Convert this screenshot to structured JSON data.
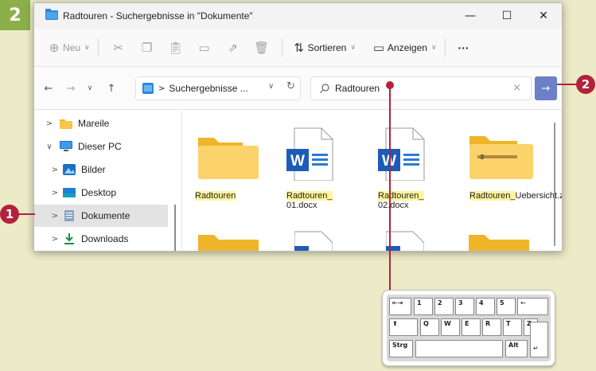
{
  "step_badge": "2",
  "window": {
    "title": "Radtouren - Suchergebnisse in \"Dokumente\"",
    "controls": {
      "minimize": "—",
      "maximize": "☐",
      "close": "✕"
    }
  },
  "toolbar": {
    "new_label": "Neu",
    "sort_label": "Sortieren",
    "view_label": "Anzeigen",
    "more_label": "···"
  },
  "address": {
    "path_label": "Suchergebnisse ...",
    "search_value": "Radtouren"
  },
  "nav_pane": {
    "items": [
      {
        "label": "Mareile",
        "arrow": ">",
        "icon": "folder-icon"
      },
      {
        "label": "Dieser PC",
        "arrow": "∨",
        "icon": "pc-icon"
      },
      {
        "label": "Bilder",
        "arrow": ">",
        "icon": "pictures-icon"
      },
      {
        "label": "Desktop",
        "arrow": ">",
        "icon": "desktop-icon"
      },
      {
        "label": "Dokumente",
        "arrow": ">",
        "icon": "document-icon"
      },
      {
        "label": "Downloads",
        "arrow": ">",
        "icon": "download-icon"
      }
    ]
  },
  "files": [
    {
      "name_hl": "Radtouren",
      "name_rest": "",
      "type": "folder"
    },
    {
      "name_hl": "Radtouren_",
      "name_rest": "01.docx",
      "type": "word"
    },
    {
      "name_hl": "Radtouren_",
      "name_rest": "02.docx",
      "type": "word"
    },
    {
      "name_hl": "Radtouren_",
      "name_rest": "Uebersicht.zip",
      "type": "zip"
    }
  ],
  "callouts": {
    "one": "1",
    "two": "2"
  },
  "keyboard": {
    "row1": [
      "1",
      "2",
      "3",
      "4",
      "5"
    ],
    "row2": [
      "Q",
      "W",
      "E",
      "R",
      "T",
      "Z"
    ],
    "ctrl": "Strg",
    "alt": "Alt"
  },
  "colors": {
    "accent": "#6c7fc7",
    "callout": "#b3213c",
    "badge": "#8bb04a",
    "highlight": "#fdf59c"
  }
}
